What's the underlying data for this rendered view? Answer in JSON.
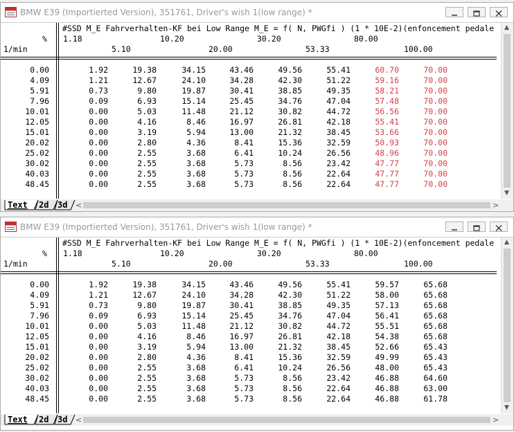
{
  "windows": [
    {
      "title": "BMW E39 (Importierted Version), 351761, Driver's wish 1(low range) *",
      "header": {
        "description": "#SSD M_E Fahrverhalten-KF bei Low Range M_E = f( N, PWGfi ) (1 * 10E-2)(enfoncement pedale",
        "col_unit": "%",
        "row_unit": "1/min",
        "top_axis": [
          "1.18",
          "10.20",
          "30.20",
          "80.00"
        ],
        "bottom_axis": [
          "5.10",
          "20.00",
          "53.33",
          "100.00"
        ]
      },
      "row_labels": [
        "0.00",
        "4.09",
        "5.91",
        "7.96",
        "10.01",
        "12.05",
        "15.01",
        "20.02",
        "25.02",
        "30.02",
        "40.03",
        "48.45"
      ],
      "rows": [
        [
          "1.92",
          "19.38",
          "34.15",
          "43.46",
          "49.56",
          "55.41",
          "60.70",
          "70.00"
        ],
        [
          "1.21",
          "12.67",
          "24.10",
          "34.28",
          "42.30",
          "51.22",
          "59.16",
          "70.00"
        ],
        [
          "0.73",
          "9.80",
          "19.87",
          "30.41",
          "38.85",
          "49.35",
          "58.21",
          "70.00"
        ],
        [
          "0.09",
          "6.93",
          "15.14",
          "25.45",
          "34.76",
          "47.04",
          "57.48",
          "70.00"
        ],
        [
          "0.00",
          "5.03",
          "11.48",
          "21.12",
          "30.82",
          "44.72",
          "56.56",
          "70.00"
        ],
        [
          "0.00",
          "4.16",
          "8.46",
          "16.97",
          "26.81",
          "42.18",
          "55.41",
          "70.00"
        ],
        [
          "0.00",
          "3.19",
          "5.94",
          "13.00",
          "21.32",
          "38.45",
          "53.66",
          "70.00"
        ],
        [
          "0.00",
          "2.80",
          "4.36",
          "8.41",
          "15.36",
          "32.59",
          "50.93",
          "70.00"
        ],
        [
          "0.00",
          "2.55",
          "3.68",
          "6.41",
          "10.24",
          "26.56",
          "48.96",
          "70.00"
        ],
        [
          "0.00",
          "2.55",
          "3.68",
          "5.73",
          "8.56",
          "23.42",
          "47.77",
          "70.00"
        ],
        [
          "0.00",
          "2.55",
          "3.68",
          "5.73",
          "8.56",
          "22.64",
          "47.77",
          "70.00"
        ],
        [
          "0.00",
          "2.55",
          "3.68",
          "5.73",
          "8.56",
          "22.64",
          "47.77",
          "70.00"
        ]
      ],
      "highlight_color": "#d0404a",
      "highlight_from_col": 6,
      "tabs": [
        "Text",
        "2d",
        "3d"
      ]
    },
    {
      "title": "BMW E39 (Importierted Version), 351761, Driver's wish 1(low range) *",
      "header": {
        "description": "#SSD M_E Fahrverhalten-KF bei Low Range M_E = f( N, PWGfi ) (1 * 10E-2)(enfoncement pedale",
        "col_unit": "%",
        "row_unit": "1/min",
        "top_axis": [
          "1.18",
          "10.20",
          "30.20",
          "80.00"
        ],
        "bottom_axis": [
          "5.10",
          "20.00",
          "53.33",
          "100.00"
        ]
      },
      "row_labels": [
        "0.00",
        "4.09",
        "5.91",
        "7.96",
        "10.01",
        "12.05",
        "15.01",
        "20.02",
        "25.02",
        "30.02",
        "40.03",
        "48.45"
      ],
      "rows": [
        [
          "1.92",
          "19.38",
          "34.15",
          "43.46",
          "49.56",
          "55.41",
          "59.57",
          "65.68"
        ],
        [
          "1.21",
          "12.67",
          "24.10",
          "34.28",
          "42.30",
          "51.22",
          "58.00",
          "65.68"
        ],
        [
          "0.73",
          "9.80",
          "19.87",
          "30.41",
          "38.85",
          "49.35",
          "57.13",
          "65.68"
        ],
        [
          "0.09",
          "6.93",
          "15.14",
          "25.45",
          "34.76",
          "47.04",
          "56.41",
          "65.68"
        ],
        [
          "0.00",
          "5.03",
          "11.48",
          "21.12",
          "30.82",
          "44.72",
          "55.51",
          "65.68"
        ],
        [
          "0.00",
          "4.16",
          "8.46",
          "16.97",
          "26.81",
          "42.18",
          "54.38",
          "65.68"
        ],
        [
          "0.00",
          "3.19",
          "5.94",
          "13.00",
          "21.32",
          "38.45",
          "52.66",
          "65.43"
        ],
        [
          "0.00",
          "2.80",
          "4.36",
          "8.41",
          "15.36",
          "32.59",
          "49.99",
          "65.43"
        ],
        [
          "0.00",
          "2.55",
          "3.68",
          "6.41",
          "10.24",
          "26.56",
          "48.00",
          "65.43"
        ],
        [
          "0.00",
          "2.55",
          "3.68",
          "5.73",
          "8.56",
          "23.42",
          "46.88",
          "64.60"
        ],
        [
          "0.00",
          "2.55",
          "3.68",
          "5.73",
          "8.56",
          "22.64",
          "46.88",
          "63.00"
        ],
        [
          "0.00",
          "2.55",
          "3.68",
          "5.73",
          "8.56",
          "22.64",
          "46.88",
          "61.78"
        ]
      ],
      "highlight_color": "#000000",
      "highlight_from_col": 99,
      "tabs": [
        "Text",
        "2d",
        "3d"
      ]
    }
  ]
}
